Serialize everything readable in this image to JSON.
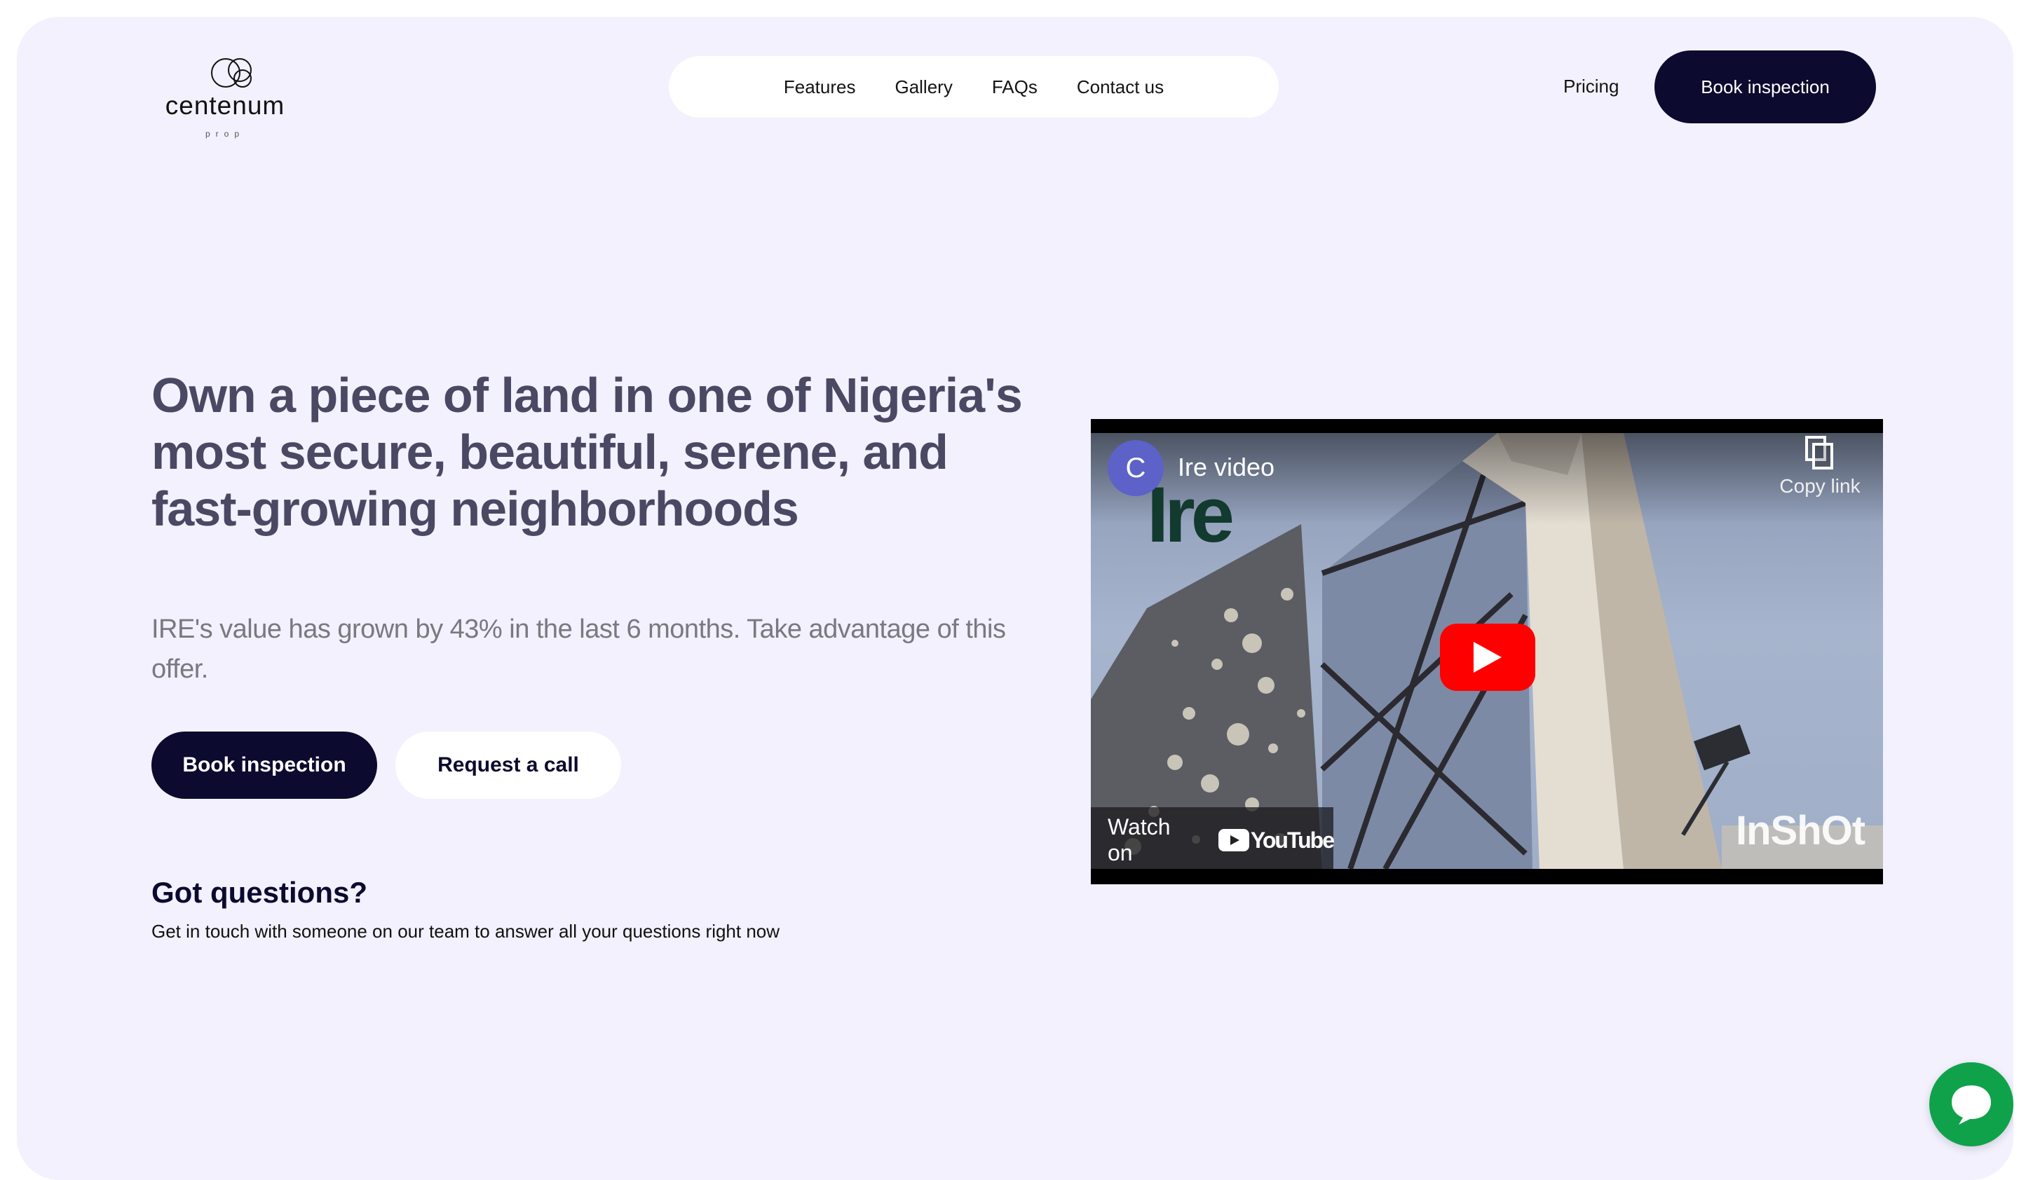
{
  "brand": {
    "logo_text": "centenum",
    "logo_sub": "prop"
  },
  "nav": {
    "links": [
      "Features",
      "Gallery",
      "FAQs",
      "Contact us"
    ],
    "pricing": "Pricing",
    "cta": "Book inspection"
  },
  "hero": {
    "title": "Own a piece of land in one of Nigeria's most secure, beautiful, serene, and fast-growing neighborhoods",
    "subtitle": "IRE's value has grown by 43% in the last 6 months. Take advantage of this offer.",
    "primary_button": "Book inspection",
    "secondary_button": "Request a call"
  },
  "questions": {
    "title": "Got questions?",
    "text": "Get in touch with someone on our team to answer all your questions right now"
  },
  "video": {
    "channel_initial": "C",
    "title": "Ire video",
    "overlay_logo": "Ire",
    "copy_link": "Copy link",
    "watch_on": "Watch on",
    "platform": "YouTube",
    "watermark": "InShOt"
  },
  "icons": {
    "chat": "chat-bubble-icon",
    "play": "play-icon",
    "copy": "copy-icon",
    "logo": "logo-mark-icon"
  },
  "colors": {
    "page_bg": "#f2f1fd",
    "primary": "#0c0a2e",
    "heading": "#4a4863",
    "youtube_red": "#ff0000",
    "chat_green": "#0fa24b"
  }
}
